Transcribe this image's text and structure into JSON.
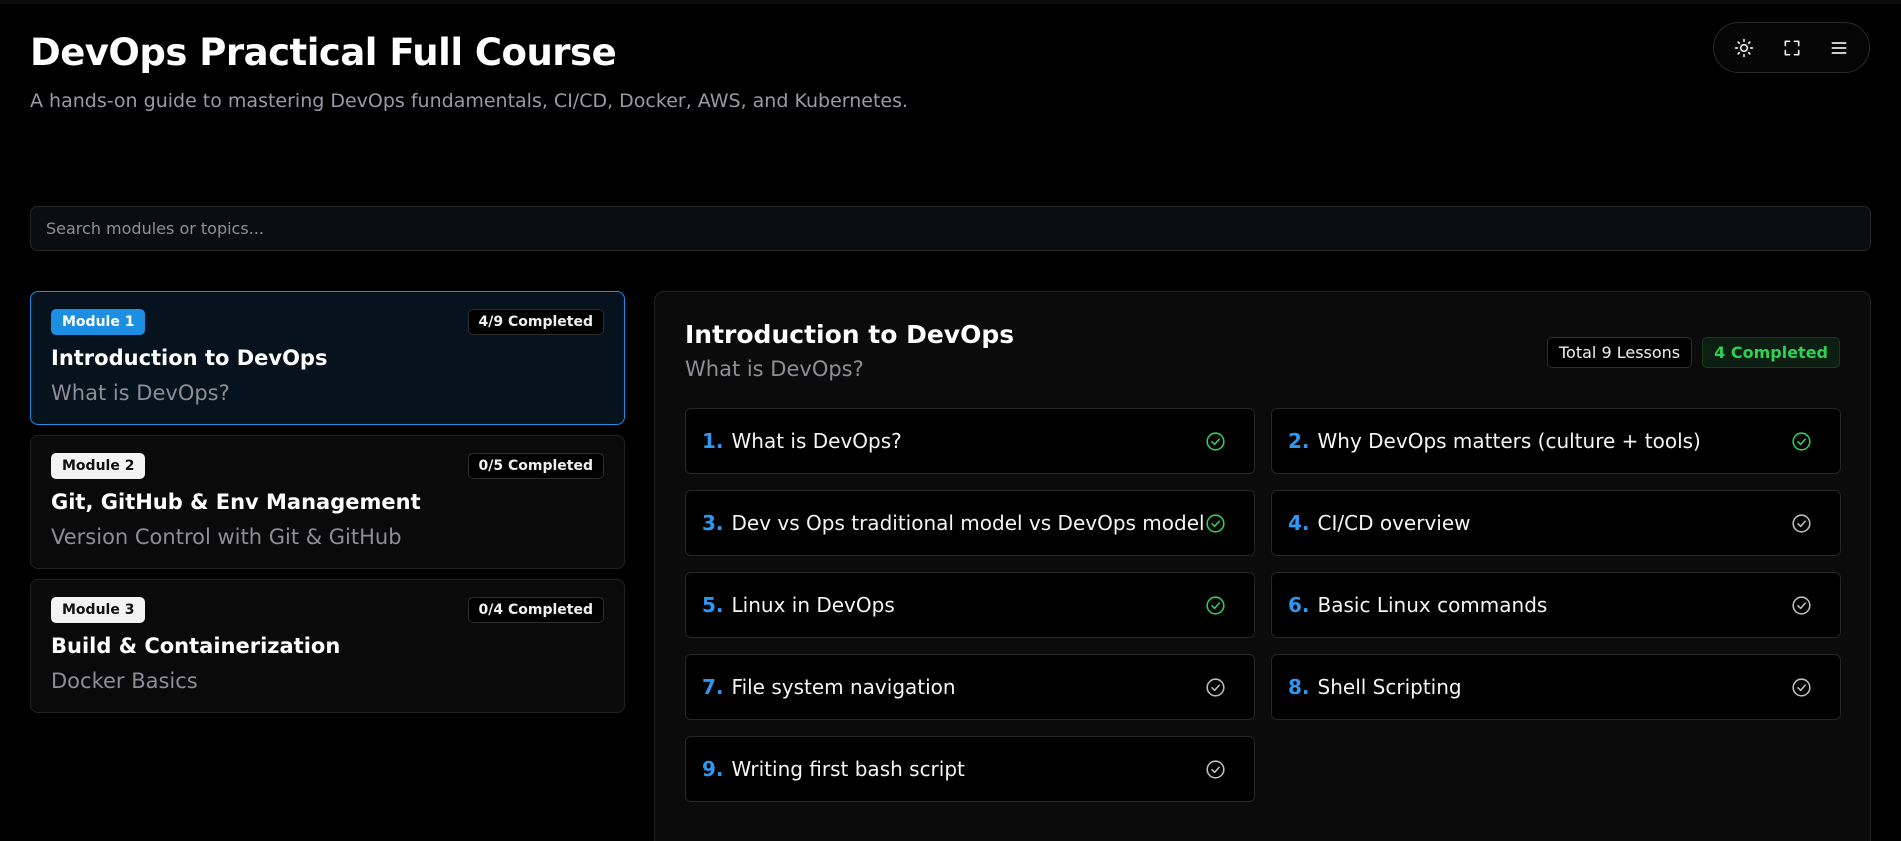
{
  "header": {
    "title": "DevOps Practical Full Course",
    "subtitle": "A hands-on guide to mastering DevOps fundamentals, CI/CD, Docker, AWS, and Kubernetes."
  },
  "controls": {
    "icons": [
      "sun-icon",
      "fullscreen-icon",
      "menu-icon"
    ]
  },
  "search": {
    "placeholder": "Search modules or topics...",
    "value": ""
  },
  "colors": {
    "accent": "#1d8fe3",
    "success": "#2fcf58",
    "background": "#000000"
  },
  "modules": [
    {
      "badge": "Module 1",
      "progress": "4/9 Completed",
      "title": "Introduction to DevOps",
      "subtitle": "What is DevOps?",
      "active": true
    },
    {
      "badge": "Module 2",
      "progress": "0/5 Completed",
      "title": "Git, GitHub & Env Management",
      "subtitle": "Version Control with Git & GitHub",
      "active": false
    },
    {
      "badge": "Module 3",
      "progress": "0/4 Completed",
      "title": "Build & Containerization",
      "subtitle": "Docker Basics",
      "active": false
    }
  ],
  "panel": {
    "title": "Introduction to DevOps",
    "subtitle": "What is DevOps?",
    "total_badge": "Total 9 Lessons",
    "completed_badge": "4 Completed",
    "lessons": [
      {
        "num": "1.",
        "title": "What is DevOps?",
        "completed": true
      },
      {
        "num": "2.",
        "title": "Why DevOps matters (culture + tools)",
        "completed": true
      },
      {
        "num": "3.",
        "title": "Dev vs Ops traditional model vs DevOps model",
        "completed": true
      },
      {
        "num": "4.",
        "title": "CI/CD overview",
        "completed": false
      },
      {
        "num": "5.",
        "title": "Linux in DevOps",
        "completed": true
      },
      {
        "num": "6.",
        "title": "Basic Linux commands",
        "completed": false
      },
      {
        "num": "7.",
        "title": "File system navigation",
        "completed": false
      },
      {
        "num": "8.",
        "title": "Shell Scripting",
        "completed": false
      },
      {
        "num": "9.",
        "title": "Writing first bash script",
        "completed": false
      }
    ]
  }
}
